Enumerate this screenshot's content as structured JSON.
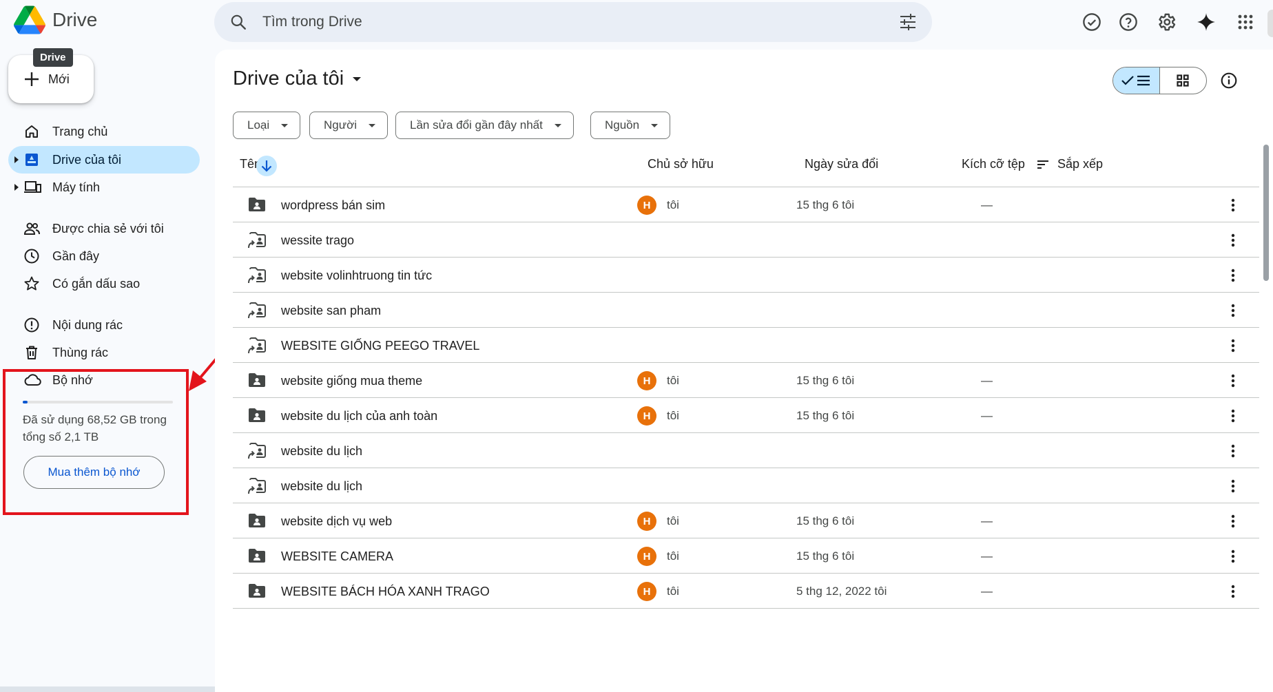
{
  "app": {
    "name": "Drive",
    "tooltip": "Drive"
  },
  "search": {
    "placeholder": "Tìm trong Drive"
  },
  "sidebar": {
    "new_label": "Mới",
    "items": [
      {
        "label": "Trang chủ",
        "icon": "home-icon"
      },
      {
        "label": "Drive của tôi",
        "icon": "my-drive-icon",
        "active": true
      },
      {
        "label": "Máy tính",
        "icon": "computers-icon"
      },
      {
        "label": "Được chia sẻ với tôi",
        "icon": "shared-icon"
      },
      {
        "label": "Gần đây",
        "icon": "recent-icon"
      },
      {
        "label": "Có gắn dấu sao",
        "icon": "star-icon"
      },
      {
        "label": "Nội dung rác",
        "icon": "spam-icon"
      },
      {
        "label": "Thùng rác",
        "icon": "trash-icon"
      },
      {
        "label": "Bộ nhớ",
        "icon": "cloud-icon"
      }
    ],
    "storage": {
      "used_fraction": 0.032,
      "text": "Đã sử dụng 68,52 GB trong tổng số 2,1 TB",
      "buy_label": "Mua thêm bộ nhớ"
    }
  },
  "main": {
    "title": "Drive của tôi",
    "filters": [
      "Loại",
      "Người",
      "Lần sửa đổi gần đây nhất",
      "Nguồn"
    ],
    "columns": {
      "name": "Tên",
      "owner": "Chủ sở hữu",
      "modified": "Ngày sửa đổi",
      "size": "Kích cỡ tệp",
      "sort": "Sắp xếp"
    },
    "rows": [
      {
        "name": "wordpress bán sim",
        "type": "folder",
        "avatar": "H",
        "owner": "tôi",
        "date": "15 thg 6 tôi",
        "size": "—"
      },
      {
        "name": "wessite trago",
        "type": "shortcut",
        "avatar": "",
        "owner": "",
        "date": "",
        "size": ""
      },
      {
        "name": "website volinhtruong tin tức",
        "type": "shortcut",
        "avatar": "",
        "owner": "",
        "date": "",
        "size": ""
      },
      {
        "name": "website san pham",
        "type": "shortcut",
        "avatar": "",
        "owner": "",
        "date": "",
        "size": ""
      },
      {
        "name": "WEBSITE GIỐNG PEEGO TRAVEL",
        "type": "shortcut",
        "avatar": "",
        "owner": "",
        "date": "",
        "size": ""
      },
      {
        "name": "website giống mua theme",
        "type": "folder",
        "avatar": "H",
        "owner": "tôi",
        "date": "15 thg 6 tôi",
        "size": "—"
      },
      {
        "name": "website du lịch của anh toàn",
        "type": "folder",
        "avatar": "H",
        "owner": "tôi",
        "date": "15 thg 6 tôi",
        "size": "—"
      },
      {
        "name": "website du lịch",
        "type": "shortcut",
        "avatar": "",
        "owner": "",
        "date": "",
        "size": ""
      },
      {
        "name": "website du lịch",
        "type": "shortcut",
        "avatar": "",
        "owner": "",
        "date": "",
        "size": ""
      },
      {
        "name": "website dịch vụ web",
        "type": "folder",
        "avatar": "H",
        "owner": "tôi",
        "date": "15 thg 6 tôi",
        "size": "—"
      },
      {
        "name": "WEBSITE CAMERA",
        "type": "folder",
        "avatar": "H",
        "owner": "tôi",
        "date": "15 thg 6 tôi",
        "size": "—"
      },
      {
        "name": "WEBSITE BÁCH HÓA XANH TRAGO",
        "type": "folder",
        "avatar": "H",
        "owner": "tôi",
        "date": "5 thg 12, 2022 tôi",
        "size": "—"
      }
    ]
  },
  "colors": {
    "accent": "#0b57d0",
    "active_bg": "#c2e7ff",
    "annotation": "#e3141c",
    "avatar": "#e8710a"
  }
}
